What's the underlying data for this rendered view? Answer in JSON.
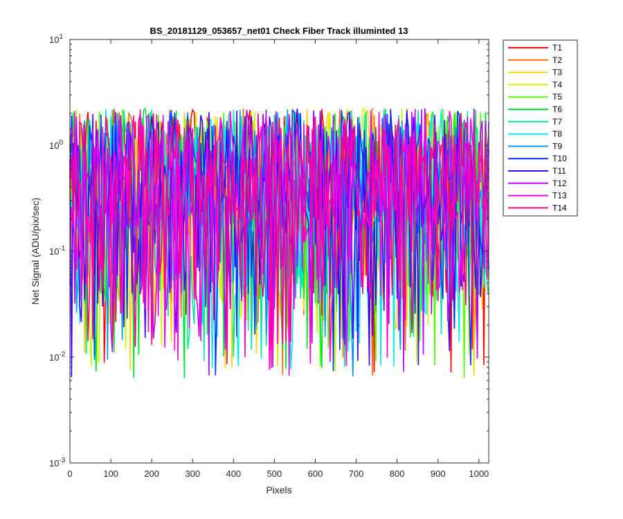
{
  "chart_data": {
    "type": "line",
    "title": "BS_20181129_053657_net01   Check Fiber     Track illuminted 13",
    "xlabel": "Pixels",
    "ylabel": "Net Signal (ADU/pix/sec)",
    "xlim": [
      0,
      1024
    ],
    "ylim": [
      0.001,
      10
    ],
    "yscale": "log",
    "x_ticks": [
      "0",
      "100",
      "200",
      "300",
      "400",
      "500",
      "600",
      "700",
      "800",
      "900",
      "1000"
    ],
    "y_ticks": [
      {
        "base": "10",
        "exp": "-3"
      },
      {
        "base": "10",
        "exp": "-2"
      },
      {
        "base": "10",
        "exp": "-1"
      },
      {
        "base": "10",
        "exp": "0"
      },
      {
        "base": "10",
        "exp": "1"
      }
    ],
    "grid": false,
    "legend_position": "outside-top-right",
    "series": [
      {
        "name": "T1",
        "color": "#ff0000"
      },
      {
        "name": "T2",
        "color": "#ff6a00"
      },
      {
        "name": "T3",
        "color": "#ffd200"
      },
      {
        "name": "T4",
        "color": "#c0ff00"
      },
      {
        "name": "T5",
        "color": "#55ff00"
      },
      {
        "name": "T6",
        "color": "#00e633"
      },
      {
        "name": "T7",
        "color": "#00e6a0"
      },
      {
        "name": "T8",
        "color": "#00eeee"
      },
      {
        "name": "T9",
        "color": "#0099ff"
      },
      {
        "name": "T10",
        "color": "#0033ff"
      },
      {
        "name": "T11",
        "color": "#4400ff"
      },
      {
        "name": "T12",
        "color": "#bb00ff"
      },
      {
        "name": "T13",
        "color": "#ff00e0"
      },
      {
        "name": "T14",
        "color": "#ff0088"
      }
    ],
    "data_note_values": {
      "typical_level": 0.5,
      "max_value": 2.5,
      "min_value": 0.0063
    }
  }
}
